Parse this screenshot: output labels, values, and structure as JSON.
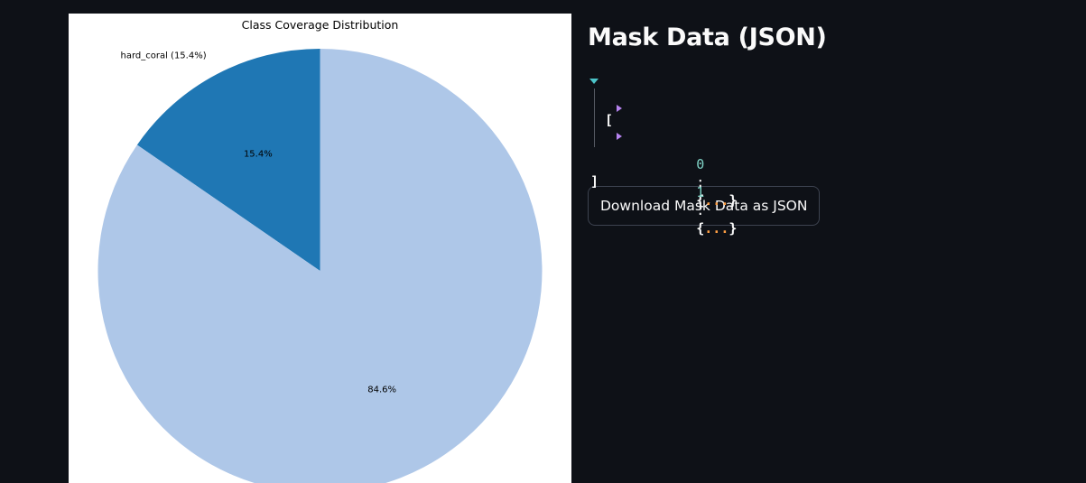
{
  "chart_data": {
    "type": "pie",
    "title": "Class Coverage Distribution",
    "slices": [
      {
        "label": "hard_coral (15.4%)",
        "pct_label": "15.4%",
        "value": 15.4,
        "color": "#1f77b4"
      },
      {
        "label": "",
        "pct_label": "84.6%",
        "value": 84.6,
        "color": "#aec7e8"
      }
    ],
    "start_angle_deg": 90,
    "direction": "counterclockwise"
  },
  "sidebar": {
    "heading": "Mask Data (JSON)"
  },
  "json_viewer": {
    "open_bracket": "[",
    "close_bracket": "]",
    "items": [
      {
        "index": "0",
        "colon": ":",
        "open": "{",
        "ellipsis": "...",
        "close": "}"
      },
      {
        "index": "1",
        "colon": ":",
        "open": "{",
        "ellipsis": "...",
        "close": "}"
      }
    ]
  },
  "download_button": {
    "label": "Download Mask Data as JSON"
  },
  "colors": {
    "background": "#0e1117",
    "text": "#fafafa",
    "caret_root": "#4cc4c9",
    "caret_item": "#b784f0",
    "key": "#7fd3c6",
    "ellipsis": "#ff9f43"
  }
}
